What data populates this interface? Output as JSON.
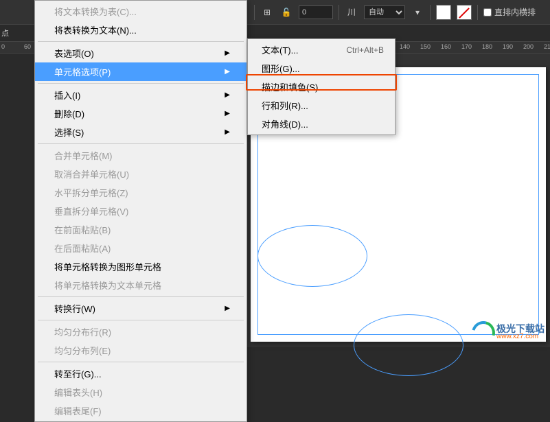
{
  "toolbar": {
    "num_value": "0",
    "select_label": "自动",
    "checkbox_label": "直排内横排"
  },
  "side_label": "点",
  "ruler_ticks": [
    0,
    60,
    "",
    "",
    "",
    "",
    "",
    "",
    140,
    150,
    160,
    170,
    180,
    190,
    200,
    21
  ],
  "ruler_positions": [
    2,
    35,
    582,
    612,
    642,
    672,
    702,
    732,
    762,
    792
  ],
  "ruler_labels_right": [
    "140",
    "150",
    "160",
    "170",
    "180",
    "190",
    "200",
    "21"
  ],
  "main_menu": [
    {
      "label": "将文本转换为表(C)...",
      "disabled": true
    },
    {
      "label": "将表转换为文本(N)...",
      "disabled": false
    },
    {
      "sep": true
    },
    {
      "label": "表选项(O)",
      "arrow": true
    },
    {
      "label": "单元格选项(P)",
      "arrow": true,
      "highlight": true
    },
    {
      "sep": true
    },
    {
      "label": "插入(I)",
      "arrow": true
    },
    {
      "label": "删除(D)",
      "arrow": true
    },
    {
      "label": "选择(S)",
      "arrow": true
    },
    {
      "sep": true
    },
    {
      "label": "合并单元格(M)",
      "disabled": true
    },
    {
      "label": "取消合并单元格(U)",
      "disabled": true
    },
    {
      "label": "水平拆分单元格(Z)",
      "disabled": true
    },
    {
      "label": "垂直拆分单元格(V)",
      "disabled": true
    },
    {
      "label": "在前面粘贴(B)",
      "disabled": true
    },
    {
      "label": "在后面粘贴(A)",
      "disabled": true
    },
    {
      "label": "将单元格转换为图形单元格",
      "disabled": false
    },
    {
      "label": "将单元格转换为文本单元格",
      "disabled": true
    },
    {
      "sep": true
    },
    {
      "label": "转换行(W)",
      "arrow": true
    },
    {
      "sep": true
    },
    {
      "label": "均匀分布行(R)",
      "disabled": true
    },
    {
      "label": "均匀分布列(E)",
      "disabled": true
    },
    {
      "sep": true
    },
    {
      "label": "转至行(G)...",
      "disabled": false
    },
    {
      "label": "编辑表头(H)",
      "disabled": true
    },
    {
      "label": "编辑表尾(F)",
      "disabled": true
    }
  ],
  "submenu": [
    {
      "label": "文本(T)...",
      "shortcut": "Ctrl+Alt+B"
    },
    {
      "label": "图形(G)..."
    },
    {
      "label": "描边和填色(S)..."
    },
    {
      "label": "行和列(R)..."
    },
    {
      "label": "对角线(D)..."
    }
  ],
  "logo": {
    "cn": "极光下载站",
    "url": "www.xz7.com"
  }
}
